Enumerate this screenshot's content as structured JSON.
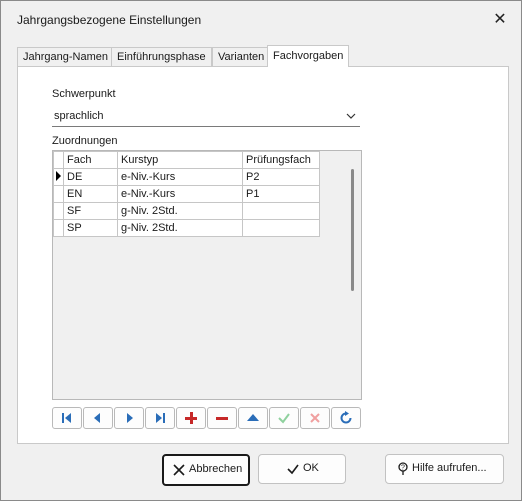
{
  "window": {
    "title": "Jahrgangsbezogene Einstellungen",
    "close_glyph": "✕"
  },
  "tabs": [
    {
      "label": "Jahrgang-Namen"
    },
    {
      "label": "Einführungsphase"
    },
    {
      "label": "Varianten"
    },
    {
      "label": "Fachvorgaben",
      "active": true
    }
  ],
  "schwerpunkt": {
    "label": "Schwerpunkt",
    "value": "sprachlich"
  },
  "zuordnungen": {
    "label": "Zuordnungen",
    "columns": [
      "Fach",
      "Kurstyp",
      "Prüfungsfach"
    ],
    "rows": [
      {
        "fach": "DE",
        "kurstyp": "e-Niv.-Kurs",
        "pruefungsfach": "P2",
        "current": true
      },
      {
        "fach": "EN",
        "kurstyp": "e-Niv.-Kurs",
        "pruefungsfach": "P1"
      },
      {
        "fach": "SF",
        "kurstyp": "g-Niv. 2Std.",
        "pruefungsfach": ""
      },
      {
        "fach": "SP",
        "kurstyp": "g-Niv. 2Std.",
        "pruefungsfach": ""
      }
    ]
  },
  "navigator": [
    {
      "name": "first-record-button",
      "icon": "first-icon",
      "enabled": true
    },
    {
      "name": "prior-record-button",
      "icon": "prior-icon",
      "enabled": true
    },
    {
      "name": "next-record-button",
      "icon": "next-icon",
      "enabled": true
    },
    {
      "name": "last-record-button",
      "icon": "last-icon",
      "enabled": true
    },
    {
      "name": "insert-record-button",
      "icon": "plus-icon",
      "enabled": true
    },
    {
      "name": "delete-record-button",
      "icon": "minus-icon",
      "enabled": true
    },
    {
      "name": "edit-record-button",
      "icon": "triangle-up-icon",
      "enabled": true
    },
    {
      "name": "post-edit-button",
      "icon": "check-icon",
      "enabled": false
    },
    {
      "name": "cancel-edit-button",
      "icon": "x-icon",
      "enabled": false
    },
    {
      "name": "refresh-button",
      "icon": "refresh-icon",
      "enabled": true
    }
  ],
  "buttons": {
    "cancel": "Abbrechen",
    "ok": "OK",
    "help": "Hilfe aufrufen..."
  },
  "colors": {
    "navigator_icon": "#2a6db8",
    "plus_minus": "#c62828",
    "disabled_check": "#8fd19e",
    "disabled_x": "#f0a0a0"
  }
}
